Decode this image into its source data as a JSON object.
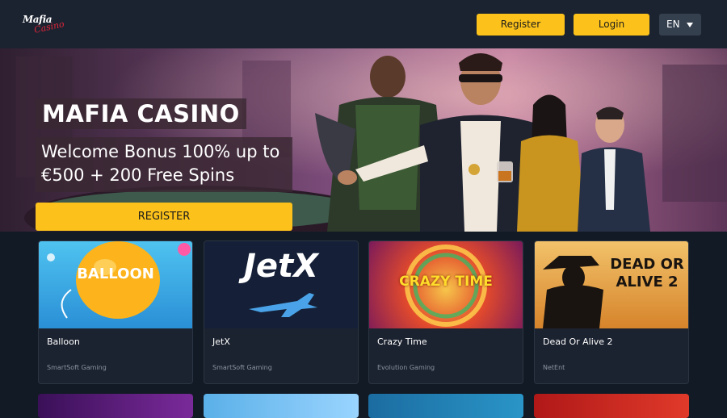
{
  "header": {
    "logo_top": "Mafia",
    "logo_script": "Casino",
    "register_label": "Register",
    "login_label": "Login",
    "language": "EN"
  },
  "hero": {
    "title": "MAFIA CASINO",
    "bonus_line1": "Welcome Bonus 100% up to",
    "bonus_line2": "€500 + 200 Free Spins",
    "cta_label": "REGISTER"
  },
  "games": [
    {
      "name": "Balloon",
      "provider": "SmartSoft Gaming",
      "thumb_text": "BALLOON"
    },
    {
      "name": "JetX",
      "provider": "SmartSoft Gaming",
      "thumb_text": "JetX"
    },
    {
      "name": "Crazy Time",
      "provider": "Evolution Gaming",
      "thumb_text": "CRAZY TIME"
    },
    {
      "name": "Dead Or Alive 2",
      "provider": "NetEnt",
      "thumb_text": "DEAD OR ALIVE 2"
    }
  ],
  "colors": {
    "background": "#121a25",
    "header": "#1c2330",
    "accent": "#fcc21b",
    "card": "#1c2330"
  }
}
